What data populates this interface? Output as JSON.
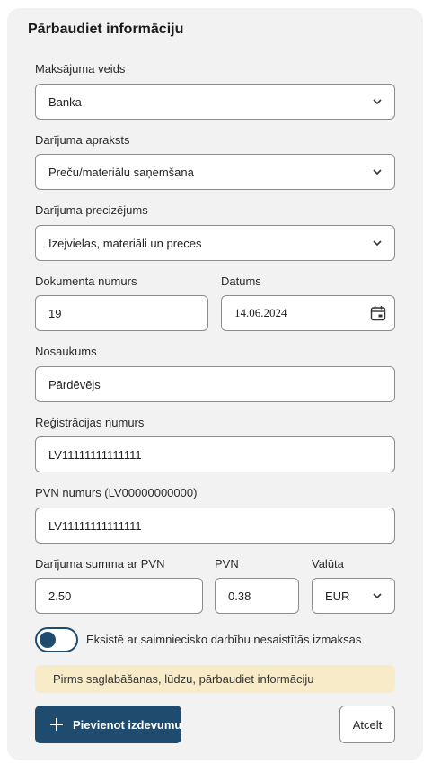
{
  "form": {
    "title": "Pārbaudiet informāciju",
    "payment_type": {
      "label": "Maksājuma veids",
      "value": "Banka"
    },
    "transaction_description": {
      "label": "Darījuma apraksts",
      "value": "Preču/materiālu saņemšana"
    },
    "transaction_detail": {
      "label": "Darījuma precizējums",
      "value": "Izejvielas, materiāli un preces"
    },
    "document_number": {
      "label": "Dokumenta numurs",
      "value": "19"
    },
    "date": {
      "label": "Datums",
      "value": "14.06.2024"
    },
    "name": {
      "label": "Nosaukums",
      "value": "Pārdēvējs"
    },
    "registration_number": {
      "label": "Reģistrācijas numurs",
      "value": "LV11111111111111"
    },
    "vat_number": {
      "label": "PVN numurs (LV00000000000)",
      "value": "LV11111111111111"
    },
    "amount_with_vat": {
      "label": "Darījuma summa ar PVN",
      "value": "2.50"
    },
    "vat": {
      "label": "PVN",
      "value": "0.38"
    },
    "currency": {
      "label": "Valūta",
      "value": "EUR"
    },
    "non_business_toggle": {
      "label": "Eksistē ar saimniecisko darbību nesaistītās izmaksas",
      "checked": false
    },
    "notice": "Pirms saglabāšanas, lūdzu, pārbaudiet informāciju",
    "add_button_label": "Pievienot izdevumu",
    "cancel_button_label": "Atcelt"
  },
  "icons": {
    "chevron": "chevron-down-icon",
    "calendar": "calendar-icon",
    "plus": "plus-icon"
  },
  "colors": {
    "primary": "#1f4c6e",
    "card_background": "#f2f2f2",
    "notice_background": "#f8ecc8",
    "border": "#8c8c8c"
  }
}
